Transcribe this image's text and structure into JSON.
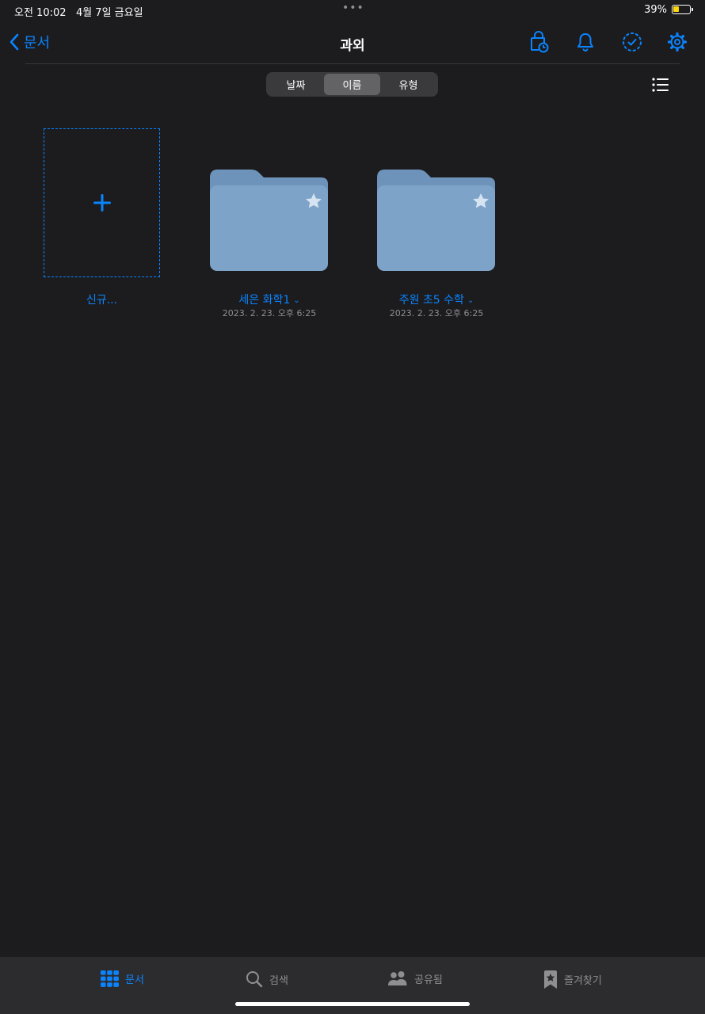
{
  "status": {
    "time": "오전 10:02",
    "date": "4월 7일 금요일",
    "battery": "39%",
    "battery_level": 0.39
  },
  "nav": {
    "back_label": "문서",
    "title": "과외"
  },
  "sort": {
    "options": [
      "날짜",
      "이름",
      "유형"
    ],
    "selected": "이름"
  },
  "new_item": {
    "label": "신규..."
  },
  "folders": [
    {
      "name": "세은 화학1",
      "date": "2023. 2. 23. 오후 6:25"
    },
    {
      "name": "주원 초5 수학",
      "date": "2023. 2. 23. 오후 6:25"
    }
  ],
  "tabs": [
    {
      "label": "문서",
      "icon": "grid-icon",
      "active": true
    },
    {
      "label": "검색",
      "icon": "search-icon",
      "active": false
    },
    {
      "label": "공유됨",
      "icon": "people-icon",
      "active": false
    },
    {
      "label": "즐겨찾기",
      "icon": "bookmark-star-icon",
      "active": false
    }
  ],
  "colors": {
    "accent": "#0a84ff",
    "background": "#1c1c1e",
    "folder": "#7ea3c9",
    "folder_tab": "#6d93bb",
    "tab_bar": "#2c2c2e",
    "battery": "#ffd60a"
  }
}
